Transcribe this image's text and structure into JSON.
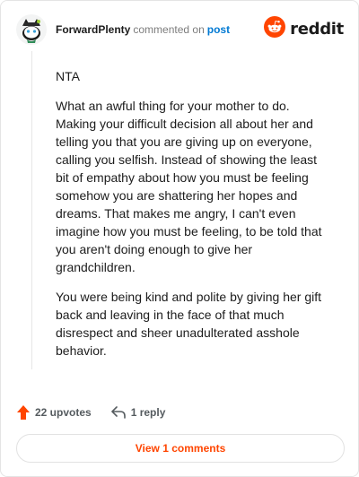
{
  "header": {
    "username": "ForwardPlenty",
    "verb": "commented on",
    "post_link": "post",
    "brand_name": "reddit",
    "brand_color": "#ff4500",
    "avatar_icon": "snoo-avatar-icon",
    "brand_icon": "reddit-logo-icon"
  },
  "comment": {
    "paragraphs": [
      "NTA",
      "What an awful thing for your mother to do. Making your difficult decision all about her and telling you that you are giving up on everyone, calling you selfish. Instead of showing the least bit of empathy about how you must be feeling somehow you are shattering her hopes and dreams. That makes me angry, I can't even imagine how you must be feeling, to be told that you aren't doing enough to give her grandchildren.",
      "You were being kind and polite by giving her gift back and leaving in the face of that much disrespect and sheer unadulterated asshole behavior."
    ]
  },
  "actions": {
    "upvotes_label": "22 upvotes",
    "reply_label": "1 reply",
    "upvote_icon": "upvote-arrow-icon",
    "reply_icon": "reply-arrow-icon"
  },
  "footer": {
    "view_comments_label": "View 1 comments"
  }
}
